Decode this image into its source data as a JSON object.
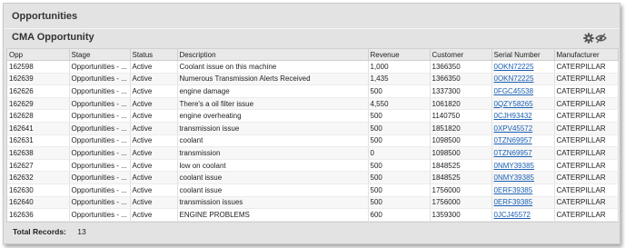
{
  "panel": {
    "title": "Opportunities"
  },
  "section": {
    "title": "CMA Opportunity"
  },
  "icons": [
    "gear-icon",
    "hide-columns-icon"
  ],
  "table": {
    "columns": [
      "Opp",
      "Stage",
      "Status",
      "Description",
      "Revenue",
      "Customer",
      "Serial Number",
      "Manufacturer"
    ],
    "rows": [
      [
        "162598",
        "Opportunities - ...",
        "Active",
        "Coolant issue on this machine",
        "1,000",
        "1366350",
        "0OKN72225",
        "CATERPILLAR"
      ],
      [
        "162639",
        "Opportunities - ...",
        "Active",
        "Numerous Transmission Alerts Received",
        "1,435",
        "1366350",
        "0OKN72225",
        "CATERPILLAR"
      ],
      [
        "162626",
        "Opportunities - ...",
        "Active",
        "engine damage",
        "500",
        "1337300",
        "0FGC45538",
        "CATERPILLAR"
      ],
      [
        "162629",
        "Opportunities - ...",
        "Active",
        "There's a oil filter issue",
        "4,550",
        "1061820",
        "0QZY58265",
        "CATERPILLAR"
      ],
      [
        "162628",
        "Opportunities - ...",
        "Active",
        "engine overheating",
        "500",
        "1140750",
        "0CJH93432",
        "CATERPILLAR"
      ],
      [
        "162641",
        "Opportunities - ...",
        "Active",
        "transmission issue",
        "500",
        "1851820",
        "0XPV45572",
        "CATERPILLAR"
      ],
      [
        "162631",
        "Opportunities - ...",
        "Active",
        "coolant",
        "500",
        "1098500",
        "0TZN69957",
        "CATERPILLAR"
      ],
      [
        "162638",
        "Opportunities - ...",
        "Active",
        "transmission",
        "0",
        "1098500",
        "0TZN69957",
        "CATERPILLAR"
      ],
      [
        "162627",
        "Opportunities - ...",
        "Active",
        "low on coolant",
        "500",
        "1848525",
        "0NMY39385",
        "CATERPILLAR"
      ],
      [
        "162632",
        "Opportunities - ...",
        "Active",
        "coolant issue",
        "500",
        "1848525",
        "0NMY39385",
        "CATERPILLAR"
      ],
      [
        "162630",
        "Opportunities - ...",
        "Active",
        "coolant issue",
        "500",
        "1756000",
        "0ERF39385",
        "CATERPILLAR"
      ],
      [
        "162640",
        "Opportunities - ...",
        "Active",
        "transmission issues",
        "500",
        "1756000",
        "0ERF39385",
        "CATERPILLAR"
      ],
      [
        "162636",
        "Opportunities - ...",
        "Active",
        "ENGINE PROBLEMS",
        "600",
        "1359300",
        "0JCJ45572",
        "CATERPILLAR"
      ]
    ]
  },
  "footer": {
    "label": "Total Records:",
    "count": "13"
  }
}
